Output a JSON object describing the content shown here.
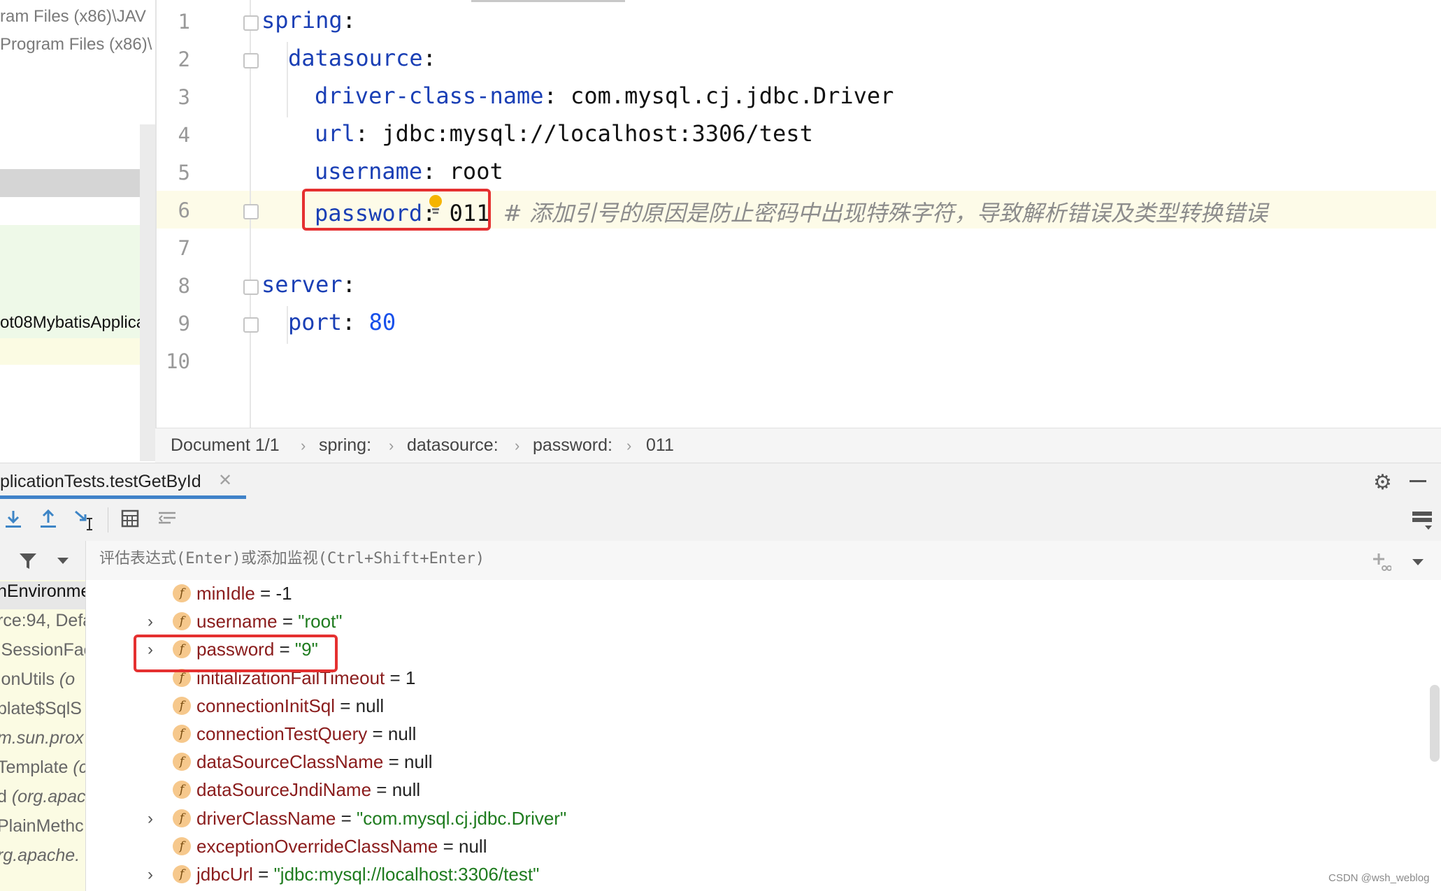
{
  "project_panel": {
    "path_line_1": "ram Files (x86)\\JAV",
    "path_line_2": "Program Files (x86)\\",
    "app_class": "ot08MybatisApplicat"
  },
  "editor": {
    "line_numbers": [
      "1",
      "2",
      "3",
      "4",
      "5",
      "6",
      "7",
      "8",
      "9",
      "10"
    ],
    "lines": {
      "l1_key": "spring",
      "l1_colon": ":",
      "l2_key": "datasource",
      "l2_colon": ":",
      "l3_key": "driver-class-name",
      "l3_rest": ": com.mysql.cj.jdbc.Driver",
      "l4_key": "url",
      "l4_rest": ": jdbc:mysql://localhost:3306/test",
      "l5_key": "username",
      "l5_rest": ": root",
      "l6_key": "password",
      "l6_rest": ": 011",
      "l6_comment": "# 添加引号的原因是防止密码中出现特殊字符，导致解析错误及类型转换错误",
      "l8_key": "server",
      "l8_colon": ":",
      "l9_key": "port",
      "l9_colon": ": ",
      "l9_value": "80"
    }
  },
  "breadcrumb": {
    "items": [
      "Document 1/1",
      "spring:",
      "datasource:",
      "password:",
      "011"
    ],
    "separator": "›"
  },
  "debug": {
    "tab_label": "plicationTests.testGetById",
    "tab_close": "✕",
    "eval_placeholder": "评估表达式(Enter)或添加监视(Ctrl+Shift+Enter)"
  },
  "frames": [
    {
      "text": "nEnvironme"
    },
    {
      "text": "rce:94, Defa"
    },
    {
      "text": "lSessionFac"
    },
    {
      "text": "ionUtils ",
      "italic": "(o"
    },
    {
      "text": "plate$SqlS"
    },
    {
      "text": "",
      "italic": "m.sun.prox"
    },
    {
      "text": "Template ",
      "italic": "(c"
    },
    {
      "text": "d ",
      "italic": "(org.apac"
    },
    {
      "text": "PlainMethc"
    },
    {
      "text": "",
      "italic": "rg.apache."
    }
  ],
  "variables": [
    {
      "name": "minIdle",
      "eq": " = ",
      "value": "-1",
      "type": "plain",
      "expandable": false
    },
    {
      "name": "username",
      "eq": " = ",
      "value": "\"root\"",
      "type": "str",
      "expandable": true
    },
    {
      "name": "password",
      "eq": " = ",
      "value": "\"9\"",
      "type": "str",
      "expandable": true
    },
    {
      "name": "initializationFailTimeout",
      "eq": " = ",
      "value": "1",
      "type": "plain",
      "expandable": false
    },
    {
      "name": "connectionInitSql",
      "eq": " = ",
      "value": "null",
      "type": "plain",
      "expandable": false
    },
    {
      "name": "connectionTestQuery",
      "eq": " = ",
      "value": "null",
      "type": "plain",
      "expandable": false
    },
    {
      "name": "dataSourceClassName",
      "eq": " = ",
      "value": "null",
      "type": "plain",
      "expandable": false
    },
    {
      "name": "dataSourceJndiName",
      "eq": " = ",
      "value": "null",
      "type": "plain",
      "expandable": false
    },
    {
      "name": "driverClassName",
      "eq": " = ",
      "value": "\"com.mysql.cj.jdbc.Driver\"",
      "type": "str",
      "expandable": true
    },
    {
      "name": "exceptionOverrideClassName",
      "eq": " = ",
      "value": "null",
      "type": "plain",
      "expandable": false
    },
    {
      "name": "jdbcUrl",
      "eq": " = ",
      "value": "\"jdbc:mysql://localhost:3306/test\"",
      "type": "str",
      "expandable": true
    }
  ],
  "field_icon_letter": "f",
  "chevron": "›",
  "watermark": "CSDN @wsh_weblog",
  "colors": {
    "highlight_box": "#e53030",
    "key": "#1a3fb5",
    "string": "#1e7b1e",
    "field_name": "#8a1c1c"
  }
}
